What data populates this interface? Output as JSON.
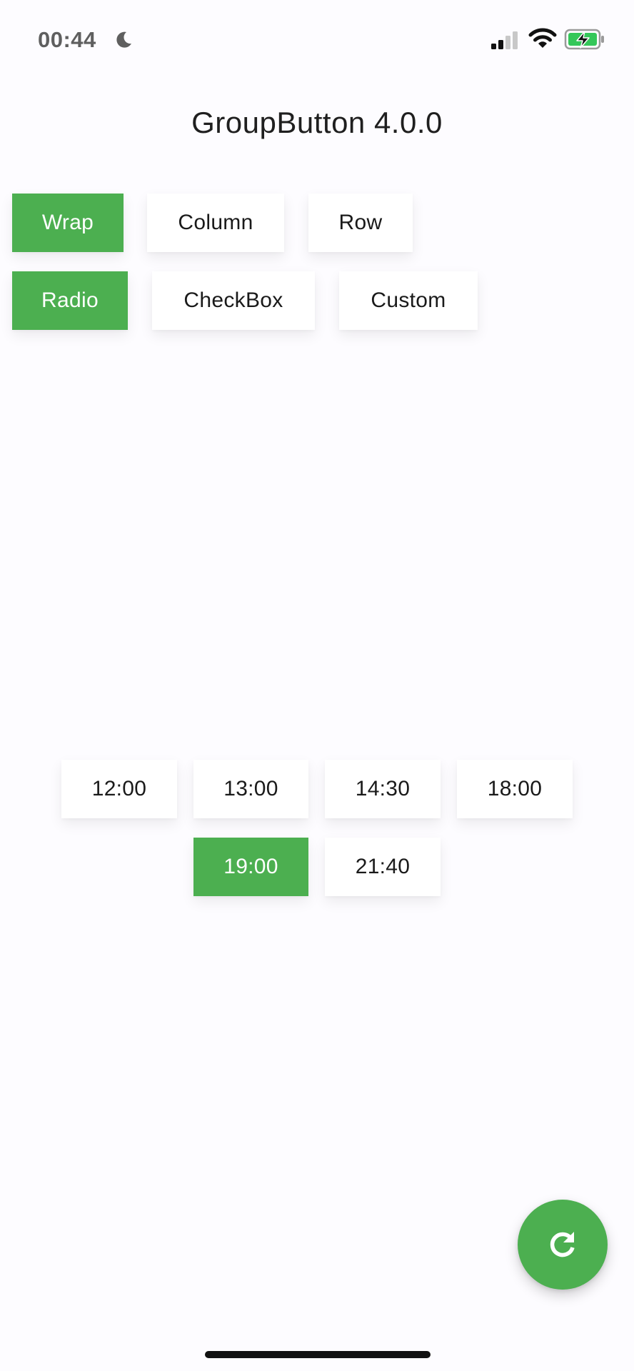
{
  "status_bar": {
    "time": "00:44",
    "icons": [
      "moon-icon",
      "signal-icon",
      "wifi-icon",
      "battery-charging-icon"
    ]
  },
  "app_bar": {
    "title": "GroupButton 4.0.0"
  },
  "layout_group": {
    "options": [
      "Wrap",
      "Column",
      "Row"
    ],
    "selected": "Wrap"
  },
  "type_group": {
    "options": [
      "Radio",
      "CheckBox",
      "Custom"
    ],
    "selected": "Radio"
  },
  "time_group": {
    "options": [
      "12:00",
      "13:00",
      "14:30",
      "18:00",
      "19:00",
      "21:40"
    ],
    "selected": "19:00"
  },
  "fab": {
    "icon": "refresh-icon"
  },
  "colors": {
    "accent": "#4caf50",
    "background": "#fdfcff",
    "button": "#ffffff",
    "text": "#1a1a1a"
  }
}
